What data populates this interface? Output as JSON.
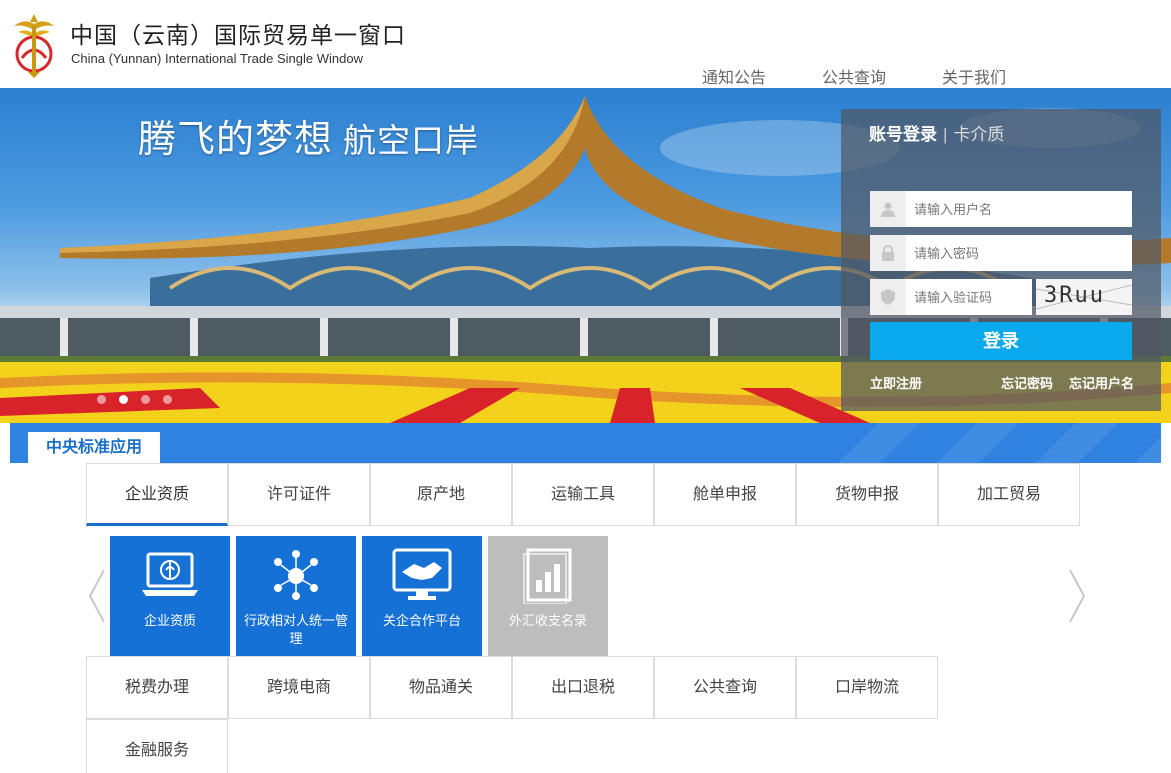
{
  "header": {
    "title_cn": "中国（云南）国际贸易单一窗口",
    "title_en": "China (Yunnan) International Trade Single Window",
    "nav": [
      "通知公告",
      "公共查询",
      "关于我们"
    ]
  },
  "banner": {
    "slogan_main": "腾飞的梦想",
    "slogan_sub": "航空口岸",
    "slide_count": 4,
    "active_slide": 2
  },
  "login": {
    "tab_account": "账号登录",
    "tab_separator": "|",
    "tab_card": "卡介质",
    "username_placeholder": "请输入用户名",
    "password_placeholder": "请输入密码",
    "captcha_placeholder": "请输入验证码",
    "captcha_text": "3Ruu",
    "login_button": "登录",
    "register_link": "立即注册",
    "forgot_password_link": "忘记密码",
    "forgot_username_link": "忘记用户名"
  },
  "section": {
    "title": "中央标准应用"
  },
  "categories_row1": [
    "企业资质",
    "许可证件",
    "原产地",
    "运输工具",
    "舱单申报",
    "货物申报",
    "加工贸易"
  ],
  "categories_row2": [
    "税费办理",
    "跨境电商",
    "物品通关",
    "出口退税",
    "公共查询",
    "口岸物流"
  ],
  "categories_row3": [
    "金融服务"
  ],
  "active_category": "企业资质",
  "tiles": [
    {
      "label": "企业资质",
      "icon": "laptop-icon",
      "color": "#1671d6"
    },
    {
      "label": "行政相对人统一管理",
      "icon": "people-network-icon",
      "color": "#1671d6"
    },
    {
      "label": "关企合作平台",
      "icon": "handshake-monitor-icon",
      "color": "#1671d6"
    },
    {
      "label": "外汇收支名录",
      "icon": "chart-book-icon",
      "color": "#bdbdbd"
    }
  ],
  "colors": {
    "brand_blue": "#1671d6",
    "login_button": "#0aa8ec",
    "section_bar": "#2f82e0"
  }
}
